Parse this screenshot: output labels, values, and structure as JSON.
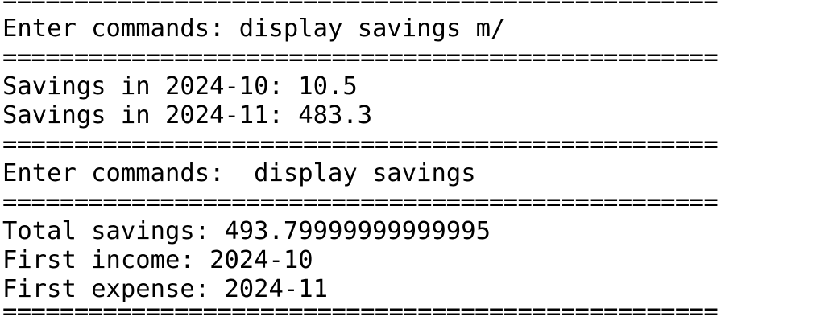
{
  "terminal": {
    "lines": [
      "==================================================",
      "Enter commands: display savings m/",
      "==================================================",
      "Savings in 2024-10: 10.5",
      "Savings in 2024-11: 483.3",
      "==================================================",
      "Enter commands:  display savings",
      "==================================================",
      "Total savings: 493.79999999999995",
      "First income: 2024-10",
      "First expense: 2024-11",
      "=================================================="
    ]
  }
}
